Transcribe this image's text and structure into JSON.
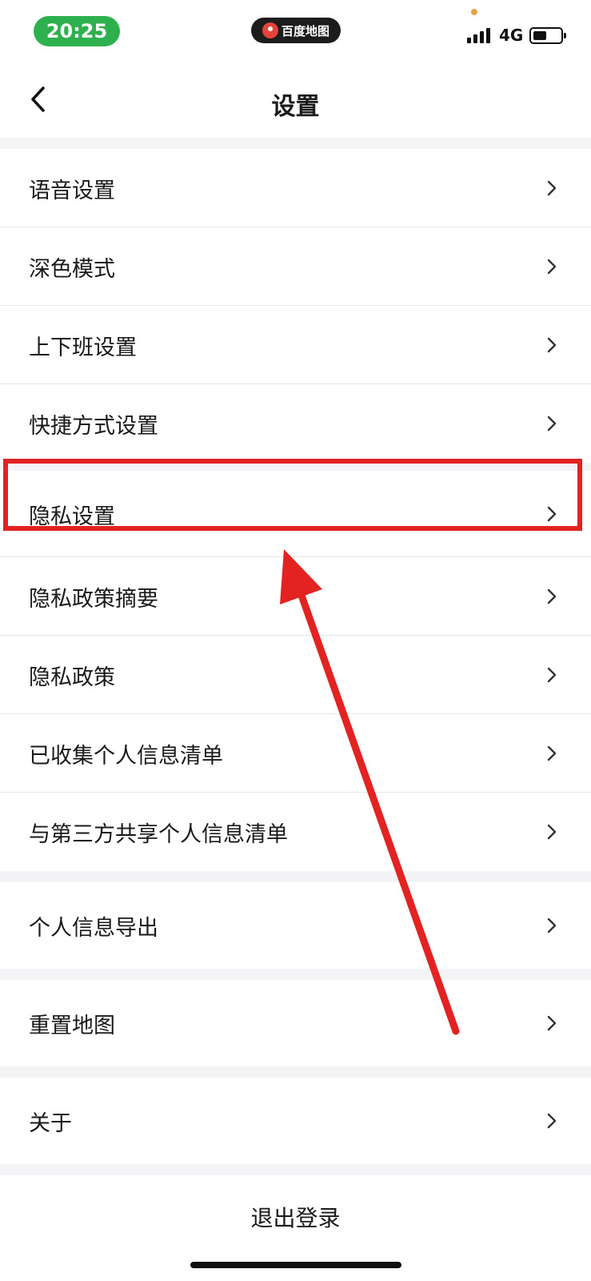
{
  "status_bar": {
    "time": "20:25",
    "app_name": "百度地图",
    "network": "4G",
    "icons": [
      "signal-icon",
      "battery-icon"
    ]
  },
  "header": {
    "title": "设置",
    "back_icon": "chevron-left-icon"
  },
  "settings": {
    "group1": [
      {
        "label": "语音设置"
      },
      {
        "label": "深色模式"
      },
      {
        "label": "上下班设置"
      },
      {
        "label": "快捷方式设置"
      }
    ],
    "group2": [
      {
        "label": "隐私设置"
      },
      {
        "label": "隐私政策摘要"
      },
      {
        "label": "隐私政策"
      },
      {
        "label": "已收集个人信息清单"
      },
      {
        "label": "与第三方共享个人信息清单"
      }
    ],
    "group3": [
      {
        "label": "个人信息导出"
      }
    ],
    "group4": [
      {
        "label": "重置地图"
      }
    ],
    "group5": [
      {
        "label": "关于"
      }
    ],
    "row_icon": "chevron-right-icon"
  },
  "logout": {
    "label": "退出登录"
  },
  "colors": {
    "time_pill": "#2fb04f",
    "annotation": "#e32222",
    "group_gap": "#f4f4f6"
  }
}
